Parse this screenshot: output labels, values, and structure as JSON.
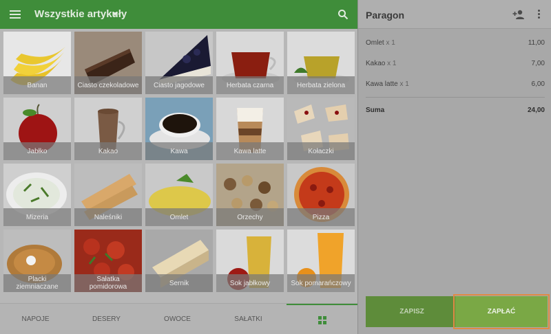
{
  "topbar": {
    "title": "Wszystkie artykuły",
    "menu_icon": "hamburger-menu-icon",
    "dropdown_icon": "caret-down-icon",
    "search_icon": "search-icon",
    "color": "#3f8d3a"
  },
  "products": [
    {
      "label": "Banan",
      "icon": "banana"
    },
    {
      "label": "Ciasto czekoladowe",
      "icon": "chocolate-cake"
    },
    {
      "label": "Ciasto jagodowe",
      "icon": "blueberry-cake"
    },
    {
      "label": "Herbata czarna",
      "icon": "black-tea"
    },
    {
      "label": "Herbata zielona",
      "icon": "green-tea"
    },
    {
      "label": "Jabłko",
      "icon": "apple"
    },
    {
      "label": "Kakao",
      "icon": "cocoa"
    },
    {
      "label": "Kawa",
      "icon": "coffee"
    },
    {
      "label": "Kawa latte",
      "icon": "latte"
    },
    {
      "label": "Kołaczki",
      "icon": "kolaczki"
    },
    {
      "label": "Mizeria",
      "icon": "mizeria"
    },
    {
      "label": "Naleśniki",
      "icon": "pancakes"
    },
    {
      "label": "Omlet",
      "icon": "omelette"
    },
    {
      "label": "Orzechy",
      "icon": "nuts"
    },
    {
      "label": "Pizza",
      "icon": "pizza"
    },
    {
      "label": "Placki ziemniaczane",
      "icon": "potato-pancakes"
    },
    {
      "label": "Sałatka pomidorowa",
      "icon": "tomato-salad"
    },
    {
      "label": "Sernik",
      "icon": "cheesecake"
    },
    {
      "label": "Sok jabłkowy",
      "icon": "apple-juice"
    },
    {
      "label": "Sok pomarańczowy",
      "icon": "orange-juice"
    }
  ],
  "tabs": [
    {
      "label": "NAPOJE"
    },
    {
      "label": "DESERY"
    },
    {
      "label": "OWOCE"
    },
    {
      "label": "SAŁATKI"
    },
    {
      "label": "",
      "icon": "grid-icon",
      "active": true
    }
  ],
  "receipt": {
    "title": "Paragon",
    "add_person_icon": "add-person-icon",
    "more_icon": "more-vert-icon",
    "items": [
      {
        "name": "Omlet",
        "qty": "x 1",
        "price": "11,00"
      },
      {
        "name": "Kakao",
        "qty": "x 1",
        "price": "7,00"
      },
      {
        "name": "Kawa latte",
        "qty": "x 1",
        "price": "6,00"
      }
    ],
    "total_label": "Suma",
    "total_value": "24,00",
    "save_label": "ZAPISZ",
    "pay_label": "ZAPŁAĆ",
    "highlight_color": "#e08a44"
  }
}
